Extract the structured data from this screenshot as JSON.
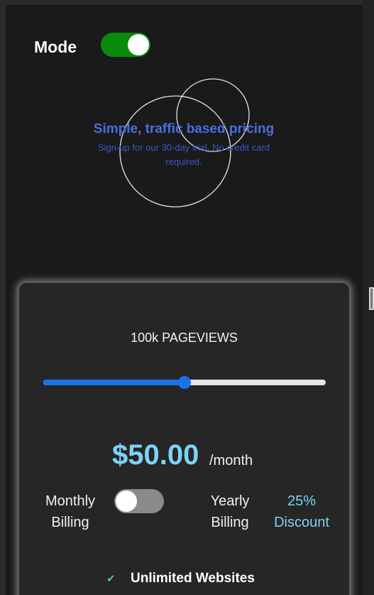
{
  "header": {
    "mode_label": "Mode",
    "mode_toggle_on": true,
    "mode_toggle_color": "#0a8a0a"
  },
  "hero": {
    "title": "Simple, traffic based pricing",
    "subtitle": "Sign-up for our 30-day trial. No credit card required."
  },
  "pricing": {
    "pageviews_label": "100k PAGEVIEWS",
    "slider_value": 0.5,
    "price": "$50.00",
    "period": "/month",
    "billing": {
      "monthly_label": "Monthly Billing",
      "yearly_label": "Yearly Billing",
      "discount_label": "25% Discount",
      "yearly_selected": false
    },
    "features": [
      {
        "icon": "check-icon",
        "label": "Unlimited Websites"
      }
    ]
  },
  "colors": {
    "accent_blue": "#1a73e8",
    "price_cyan": "#7dd3f5",
    "title_blue": "#4a6ee0",
    "check_teal": "#3ec9b0"
  }
}
